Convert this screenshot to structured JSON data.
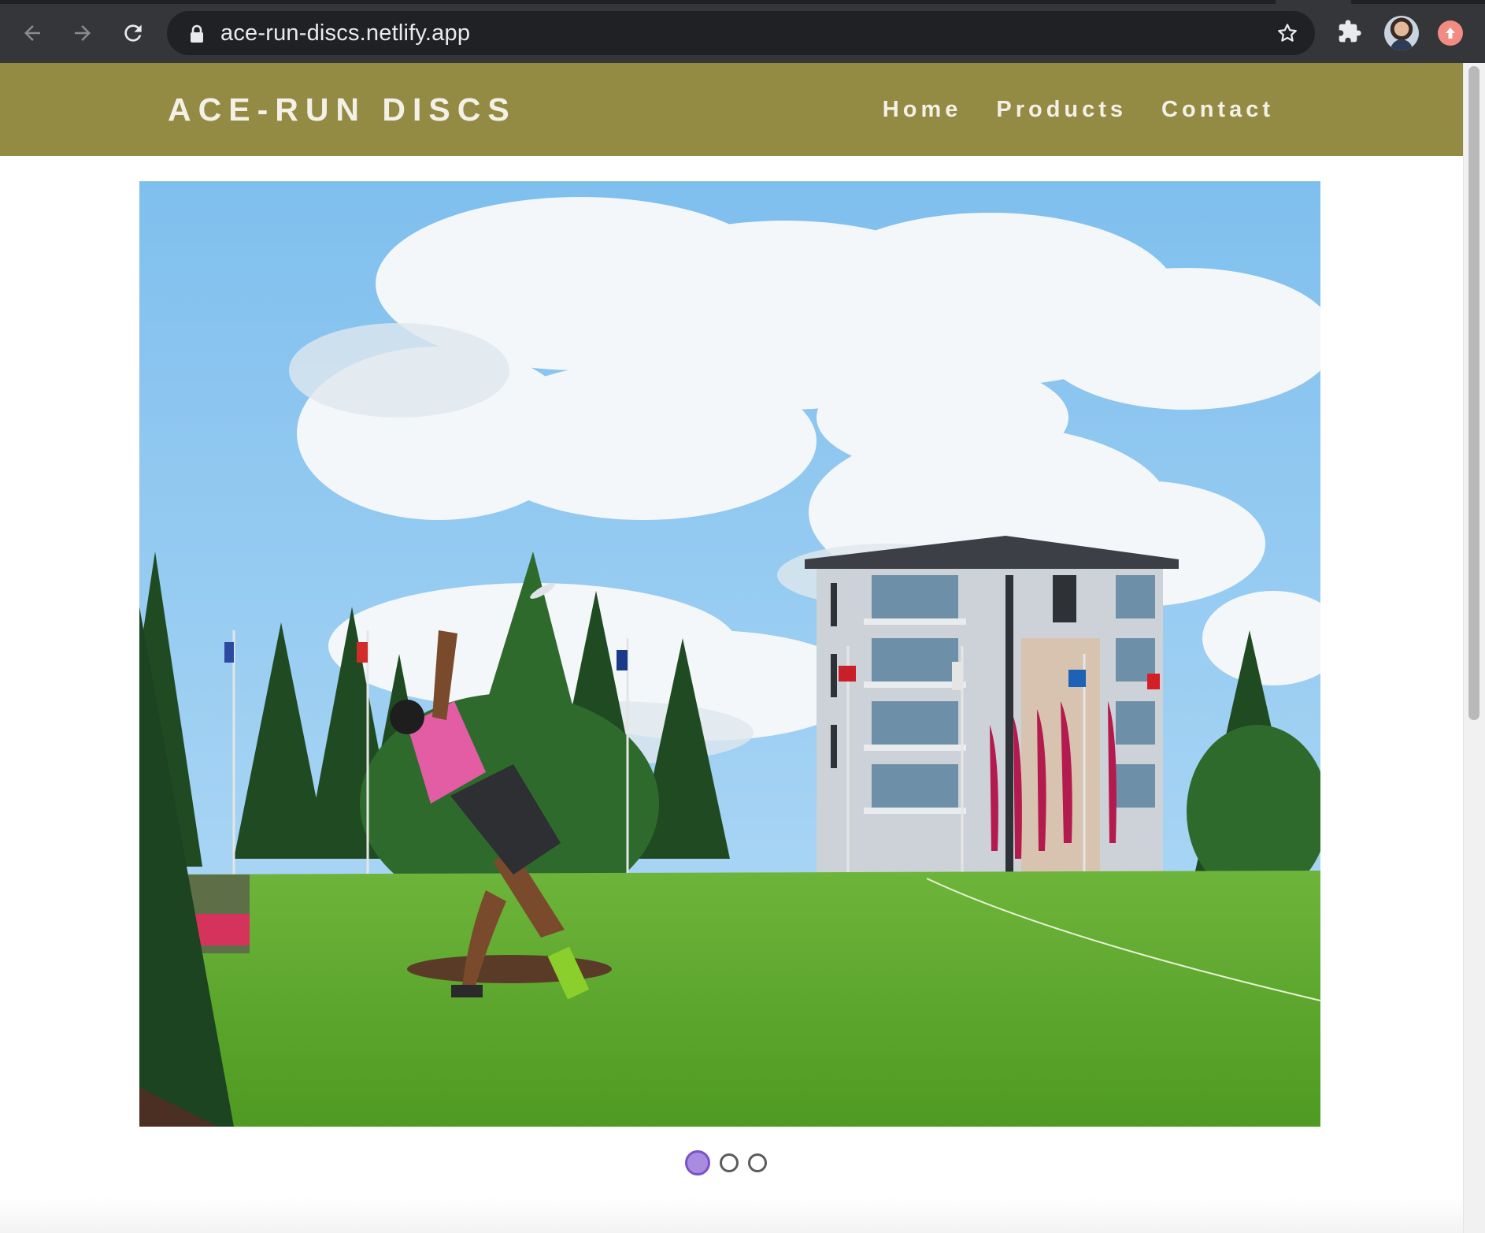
{
  "browser": {
    "url": "ace-run-discs.netlify.app",
    "icons": [
      "back-arrow-icon",
      "forward-arrow-icon",
      "reload-icon",
      "lock-icon",
      "bookmark-star-icon",
      "extensions-puzzle-icon",
      "profile-avatar",
      "update-icon"
    ]
  },
  "site": {
    "brand": "ACE-RUN DISCS",
    "nav": [
      "Home",
      "Products",
      "Contact"
    ],
    "accent_color": "#938a44"
  },
  "carousel": {
    "slide_count": 3,
    "active_index": 0,
    "slide_description": "disc golf player throwing a disc on a grassy hill with trees, flags and an apartment building under a cloudy blue sky"
  }
}
